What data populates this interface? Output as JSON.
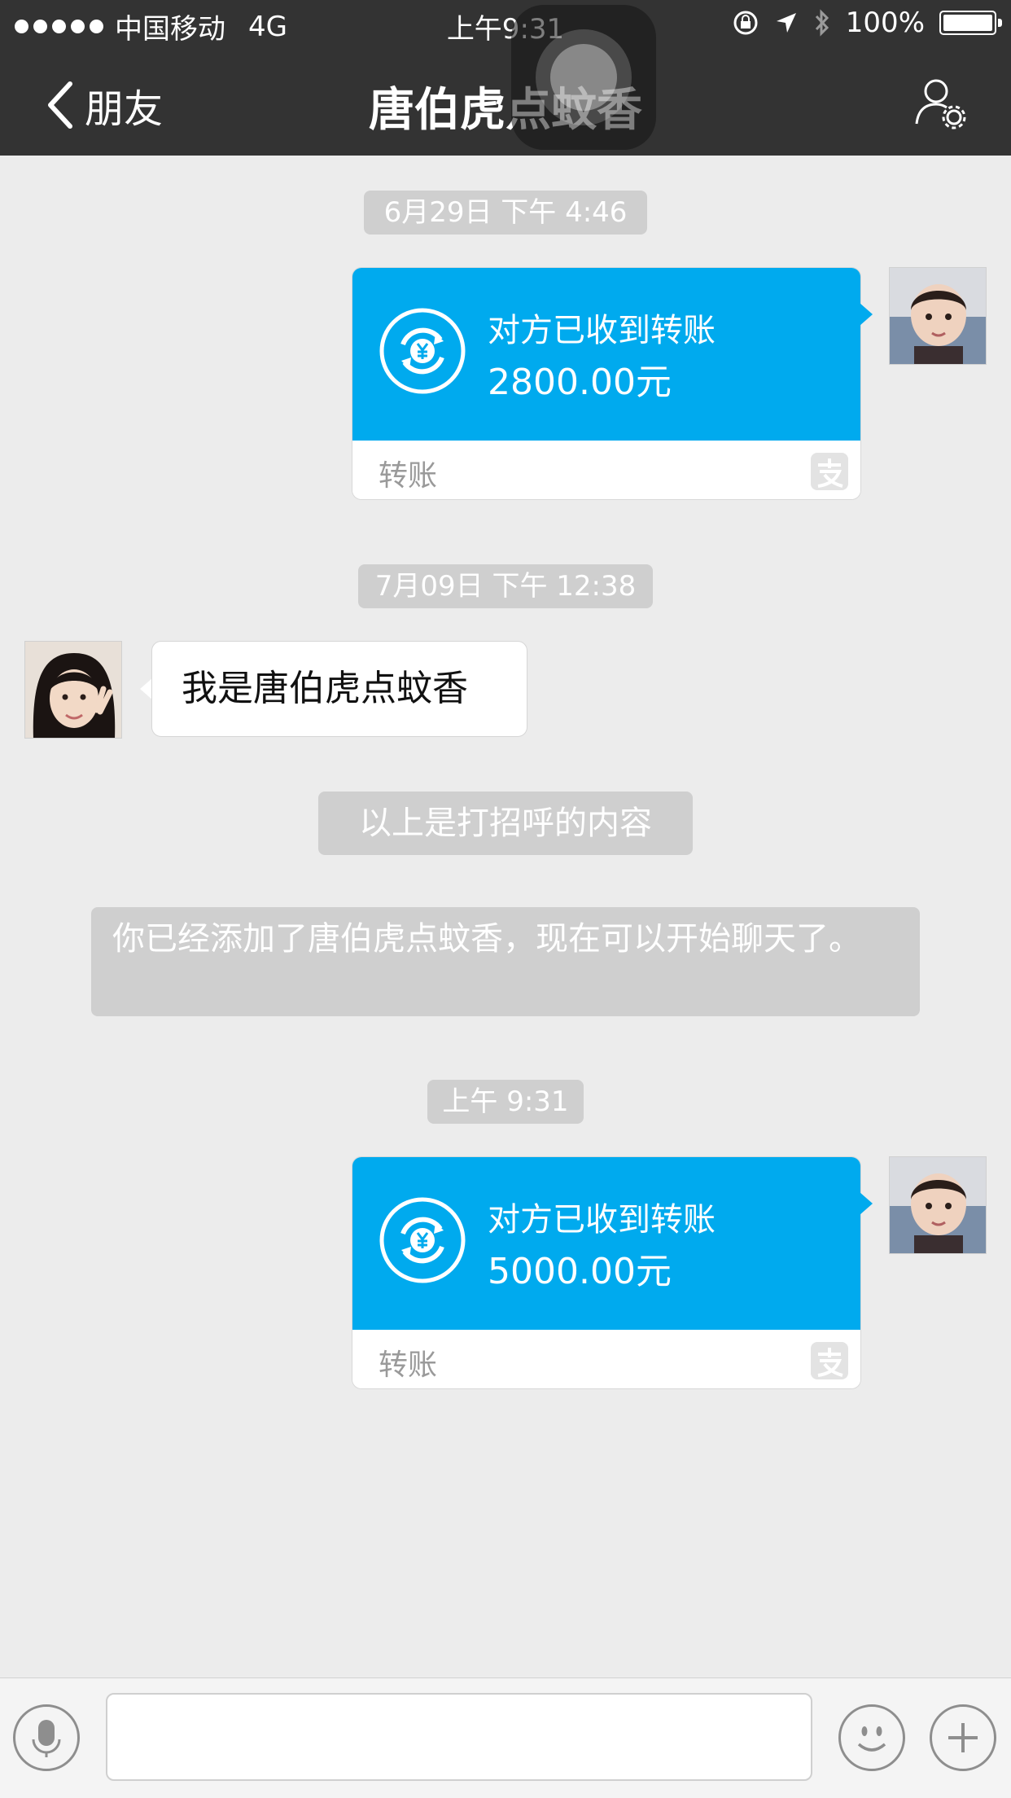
{
  "status_bar": {
    "carrier": "中国移动",
    "network": "4G",
    "time": "上午9:31",
    "battery": "100%"
  },
  "nav": {
    "back_label": "朋友",
    "title": "唐伯虎点蚊香"
  },
  "messages": {
    "ts1": "6月29日 下午 4:46",
    "transfer1": {
      "status": "对方已收到转账",
      "amount": "2800.00元",
      "label": "转账"
    },
    "ts2": "7月09日 下午 12:38",
    "incoming_text": "我是唐伯虎点蚊香",
    "system_greeting": "以上是打招呼的内容",
    "system_added": "你已经添加了唐伯虎点蚊香，现在可以开始聊天了。",
    "ts3": "上午 9:31",
    "transfer2": {
      "status": "对方已收到转账",
      "amount": "5000.00元",
      "label": "转账"
    }
  },
  "input": {
    "placeholder": ""
  },
  "colors": {
    "nav_bg": "#333333",
    "chat_bg": "#ececec",
    "transfer_blue": "#00aaee",
    "chip_gray": "#cfcfcf"
  }
}
